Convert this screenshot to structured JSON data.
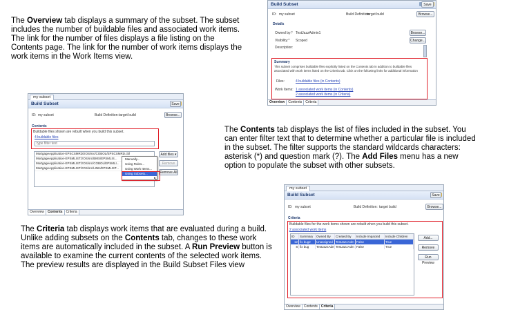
{
  "paragraphs": {
    "overview": {
      "pre": "The ",
      "bold": "Overview",
      "post": " tab displays a summary of the subset. The subset includes the number of buildable files and associated work items. The link for the number of files displays a file listing on the Contents page. The link for the number of work items displays the work items in the Work Items view."
    },
    "contents": {
      "pre": "The ",
      "bold": "Contents",
      "mid": " tab displays the list of files included in the subset. You can enter filter text that to determine whether a particular file is included in the subset. The filter supports the standard wildcards characters: asterisk (*) and question mark (?). The ",
      "bold2": "Add Files",
      "post": " menu has a new option to populate the subset with other subsets."
    },
    "criteria": {
      "pre": "The ",
      "bold": "Criteria",
      "mid": " tab displays work items that are evaluated during a build. Unlike adding subsets on the ",
      "bold2": "Contents",
      "mid2": " tab, changes to these work items are automatically included in the subset. A ",
      "bold3": "Run Preview",
      "post": " button is available to examine the current contents of the selected work items. The preview  results are displayed in the Build Subset Files view"
    }
  },
  "common": {
    "editor_tab": "my subset",
    "header_title": "Build Subset",
    "save_label": "Save",
    "id_label": "ID:",
    "id_value": "my subset",
    "build_def_label": "Build Definition:",
    "build_def_value": "target build",
    "browse_label": "Browse...",
    "tabs": [
      "Overview",
      "Contents",
      "Criteria"
    ]
  },
  "overview_shot": {
    "details_label": "Details",
    "owned_by_label": "Owned by:*",
    "owned_by_value": "TestJazzAdmin1",
    "visibility_label": "Visibility:*",
    "visibility_value": "Scoped",
    "description_label": "Description:",
    "change_label": "Change...",
    "summary_label": "Summary",
    "summary_text": "This subset comprises buildable files explicitly listed on the Contents tab in addition to buildable files associated with work items listed on the Criteria tab.  Click on the following links for additional information",
    "files_label": "Files:",
    "files_link": "4 buildable files (in Contents)",
    "work_items_label": "Work Items:",
    "work_items_links": [
      "1 associated work items (in Contents)",
      "2 associated work items (in Criteria)"
    ]
  },
  "contents_shot": {
    "contents_label": "Contents",
    "note": "Buildable files shown are rebuilt when you build this subset.",
    "count_link": "4 buildable files",
    "filter_placeholder": "type filter text",
    "files": [
      "MortgageApplication-EPSCSMRD/zOS/src/COBOL/EPSCSMRD.cbl",
      "MortgageApplication-EPSMLIST/zOS/src/BMS/EPSMLIS...",
      "MortgageApplication-EPSMLIST/zOS/src/COBOL/EPSMLI...",
      "MortgageApplication-EPSMLIST/zOS/src/LINK/EPSMLIST..."
    ],
    "add_files_label": "Add files",
    "remove_label": "Remove",
    "remove_all_label": "Remove All",
    "menu_items": [
      "Manually...",
      "Using Rules...",
      "Using Work Items...",
      "Using Subsets..."
    ]
  },
  "criteria_shot": {
    "criteria_label": "Criteria",
    "note": "Buildable files for the work items shown are rebuilt when you build this subset.",
    "count_link": "2 associated work items",
    "columns": [
      "ID",
      "Summary",
      "Owned By",
      "Created By",
      "Include Impacted",
      "Include Children"
    ],
    "rows": [
      [
        "12",
        "fix bug2",
        "Unassigned",
        "TestJazzAdm",
        "False",
        "True"
      ],
      [
        "8",
        "fix bug",
        "TestJazzAdm",
        "TestJazzAdm",
        "False",
        "True"
      ]
    ],
    "add_label": "Add...",
    "remove_label": "Remove",
    "run_preview_label": "Run Preview"
  },
  "colors": {
    "highlight_box": "#e0202a",
    "link": "#2a47b8",
    "selection": "#3a66d6"
  }
}
